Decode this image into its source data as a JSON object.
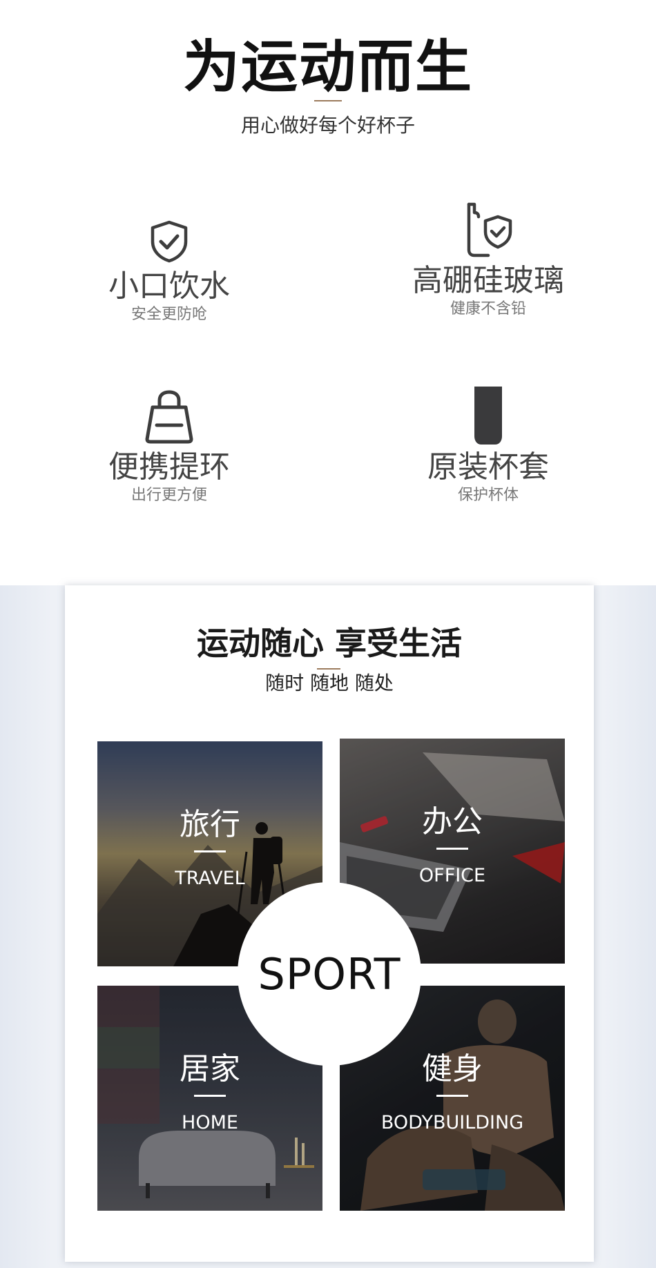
{
  "header": {
    "title": "为运动而生",
    "subtitle": "用心做好每个好杯子"
  },
  "features": [
    {
      "icon": "shield-check-icon",
      "title": "小口饮水",
      "subtitle": "安全更防呛"
    },
    {
      "icon": "glass-shield-icon",
      "title": "高硼硅玻璃",
      "subtitle": "健康不含铅"
    },
    {
      "icon": "handbag-icon",
      "title": "便携提环",
      "subtitle": "出行更方便"
    },
    {
      "icon": "cup-sleeve-icon",
      "title": "原装杯套",
      "subtitle": "保护杯体"
    }
  ],
  "scenes": {
    "title": "运动随心 享受生活",
    "subtitle": "随时 随地 随处",
    "center_label": "SPORT",
    "tiles": [
      {
        "cn": "旅行",
        "en": "TRAVEL"
      },
      {
        "cn": "办公",
        "en": "OFFICE"
      },
      {
        "cn": "居家",
        "en": "HOME"
      },
      {
        "cn": "健身",
        "en": "BODYBUILDING"
      }
    ]
  },
  "colors": {
    "accent_rule": "#9b7a5c",
    "icon_stroke": "#3d3d3d",
    "panel_bg": "#eef1f6"
  }
}
